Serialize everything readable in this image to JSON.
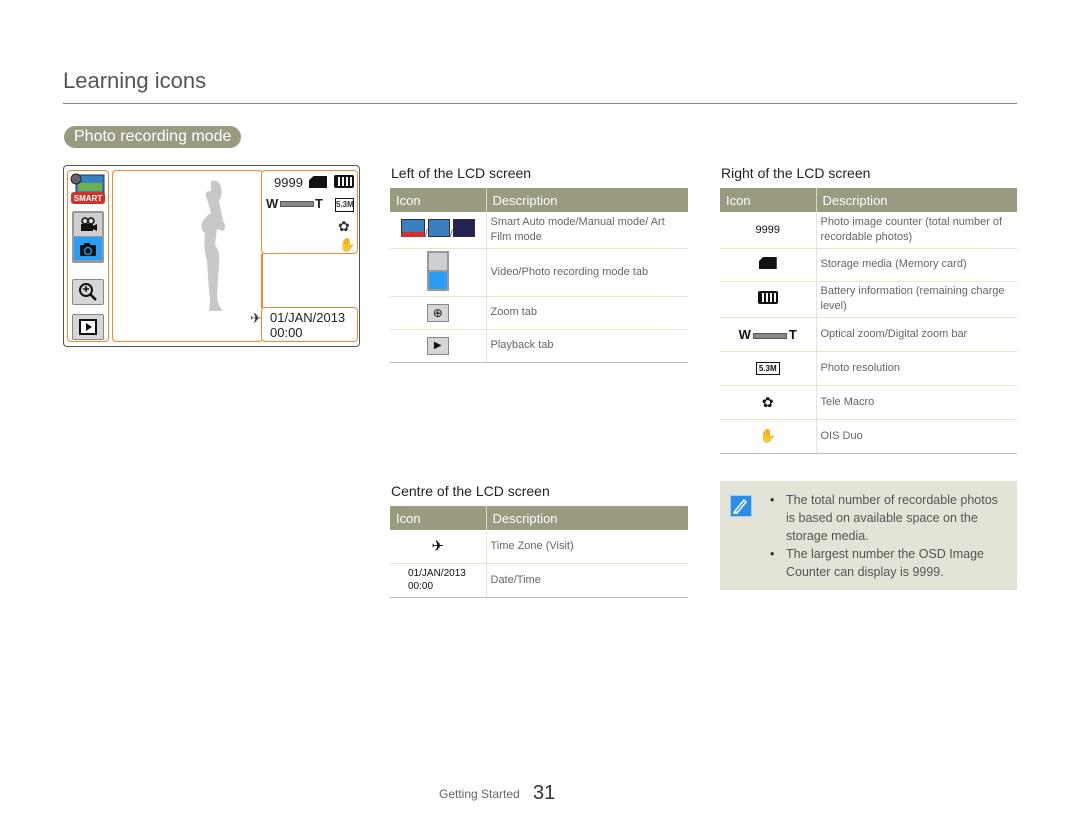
{
  "page": {
    "title": "Learning icons",
    "section": "Photo recording mode"
  },
  "lcd": {
    "counter": "9999",
    "date": "01/JAN/2013",
    "time": "00:00",
    "smart_label": "SMART",
    "zoom_w": "W",
    "zoom_t": "T"
  },
  "left_table": {
    "title": "Left of the LCD screen",
    "headers": [
      "Icon",
      "Description"
    ],
    "rows": [
      {
        "icon": "smart-auto-manual-artfilm-icons",
        "description": "Smart Auto mode/Manual mode/ Art Film mode"
      },
      {
        "icon": "video-photo-mode-tab-icon",
        "description": "Video/Photo recording mode tab"
      },
      {
        "icon": "zoom-tab-icon",
        "description": "Zoom tab"
      },
      {
        "icon": "playback-tab-icon",
        "description": "Playback tab"
      }
    ]
  },
  "right_table": {
    "title": "Right of the LCD screen",
    "headers": [
      "Icon",
      "Description"
    ],
    "rows": [
      {
        "icon_text": "9999",
        "description": "Photo image counter (total number of recordable photos)"
      },
      {
        "icon": "memory-card-icon",
        "description": "Storage media (Memory card)"
      },
      {
        "icon": "battery-icon",
        "description": "Battery information (remaining charge level)"
      },
      {
        "icon": "zoom-bar-icon",
        "description": "Optical zoom/Digital zoom bar"
      },
      {
        "icon": "photo-resolution-icon",
        "description": "Photo resolution"
      },
      {
        "icon": "tele-macro-icon",
        "description": "Tele Macro"
      },
      {
        "icon": "ois-duo-icon",
        "description": "OIS Duo"
      }
    ]
  },
  "centre_table": {
    "title": "Centre of the LCD screen",
    "headers": [
      "Icon",
      "Description"
    ],
    "rows": [
      {
        "icon": "time-zone-visit-icon",
        "description": "Time Zone (Visit)"
      },
      {
        "icon_text": "01/JAN/2013",
        "icon_text2": "00:00",
        "description": "Date/Time"
      }
    ]
  },
  "note": {
    "items": [
      "The total number of recordable photos is based on available space on the storage media.",
      "The largest number the OSD Image Counter can display is 9999."
    ]
  },
  "footer": {
    "label": "Getting Started",
    "page_number": "31"
  },
  "colors": {
    "header_bg": "#9a9a80",
    "lcd_frame_accent": "#f08a30",
    "note_bg": "#e3e3d8",
    "photo_tab_blue": "#2a9df4"
  }
}
